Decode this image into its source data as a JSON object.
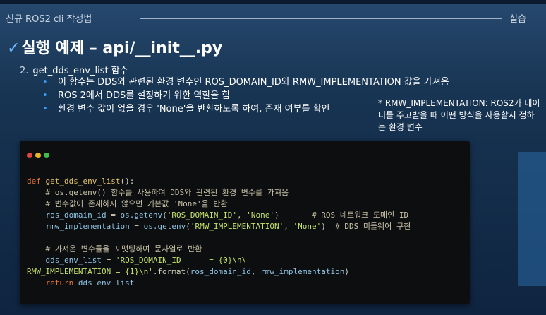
{
  "header": {
    "title": "신규 ROS2 cli 작성법",
    "tag": "실습"
  },
  "slide": {
    "title": "실행 예제 – api/__init__.py",
    "section_number": "2.",
    "section_title": "get_dds_env_list 함수",
    "bullets": [
      "이 함수는 DDS와 관련된 환경 변수인 ROS_DOMAIN_ID와 RMW_IMPLEMENTATION 값을 가져옴",
      "ROS 2에서 DDS를 설정하기 위한 역할을 함",
      "환경 변수 값이 없을 경우 'None'을 반환하도록 하여, 존재 여부를 확인"
    ],
    "note": "* RMW_IMPLEMENTATION: ROS2가 데이터를 주고받을 때 어떤 방식을 사용할지 정하는 환경 변수"
  },
  "code": {
    "kw_def": "def",
    "func_name": "get_dds_env_list",
    "sig_tail": "():",
    "comment1": "# os.getenv() 함수를 사용하여 DDS와 관련된 환경 변수를 가져옴",
    "comment2": "# 변수값이 존재하지 않으면 기본값 'None'을 반환",
    "var1": "ros_domain_id",
    "var2": "rmw_implementation",
    "getenv": "os.getenv",
    "str_domain": "'ROS_DOMAIN_ID'",
    "str_rmw": "'RMW_IMPLEMENTATION'",
    "str_none": "'None'",
    "comment3": "# ROS 네트워크 도메인 ID",
    "comment4": "# DDS 미들웨어 구현",
    "comment5": "# 가져온 변수들을 포맷팅하여 문자열로 반환",
    "var3": "dds_env_list",
    "str_fmt1": "'ROS_DOMAIN_ID      = {0}\\n\\",
    "str_fmt2": "RMW_IMPLEMENTATION = {1}\\n'",
    "format_call": ".format(",
    "format_args": "ros_domain_id, rmw_implementation",
    "kw_return": "return",
    "return_val": "dds_env_list"
  },
  "colors": {
    "dot_red": "#e2473f",
    "dot_yellow": "#e9b428",
    "dot_green": "#3fbf4a"
  }
}
